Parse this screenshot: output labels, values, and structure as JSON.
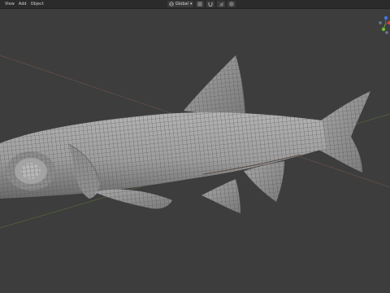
{
  "header": {
    "menu": [
      "View",
      "Add",
      "Object"
    ],
    "transform_orientation": "Global"
  },
  "gizmo": {
    "colors": {
      "x": "#d6403f",
      "y": "#6fba37",
      "z": "#3e7bdc",
      "neg": "#6b7a92"
    }
  },
  "viewport": {
    "background": "#3d3d3d",
    "mesh_color": "#9b9b9b",
    "wire_color": "#4b4b4b"
  }
}
